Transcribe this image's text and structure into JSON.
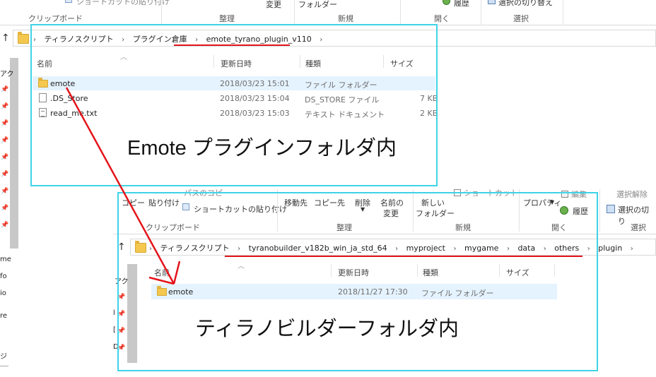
{
  "top_window": {
    "ribbon": {
      "shortcut_paste": "ショートカットの貼り付け",
      "clipboard": "クリップボード",
      "organize": "整理",
      "change": "変更",
      "folder": "フォルダー",
      "new": "新規",
      "open": "開く",
      "history": "履歴",
      "select_toggle": "選択の切り替え",
      "select": "選択"
    },
    "breadcrumb": [
      "ティラノスクリプト",
      "プラグイン倉庫",
      "emote_tyrano_plugin_v110"
    ],
    "columns": [
      "名前",
      "更新日時",
      "種類",
      "サイズ"
    ],
    "rows": [
      {
        "name": "emote",
        "date": "2018/03/23 15:01",
        "type": "ファイル フォルダー",
        "size": "",
        "icon": "folder-icon"
      },
      {
        "name": ".DS_Store",
        "date": "2018/03/23 15:04",
        "type": "DS_STORE ファイル",
        "size": "7 KB",
        "icon": "file-icon"
      },
      {
        "name": "read_me.txt",
        "date": "2018/03/23 15:03",
        "type": "テキスト ドキュメント",
        "size": "2 KB",
        "icon": "text-file-icon"
      }
    ],
    "sidebar_fragments": [
      "アク",
      "me",
      "fo",
      "io",
      "re",
      "ジ"
    ]
  },
  "bottom_window": {
    "ribbon": {
      "copy": "コピー",
      "paste": "貼り付け",
      "paste_path": "パスのコピー",
      "shortcut_paste": "ショートカットの貼り付け",
      "move_to": "移動先",
      "copy_to": "コピー先",
      "delete": "削除",
      "rename_1": "名前の",
      "rename_2": "変更",
      "new_1": "新しい",
      "new_2": "フォルダー",
      "shortcut": "ショートカット",
      "properties": "プロパティ",
      "edit": "編集",
      "history": "履歴",
      "select_all_clear": "選択解除",
      "select_toggle": "選択の切り",
      "clipboard": "クリップボード",
      "organize": "整理",
      "new": "新規",
      "open": "開く",
      "select": "選択"
    },
    "breadcrumb": [
      "ティラノスクリプト",
      "tyranobuilder_v182b_win_ja_std_64",
      "myproject",
      "mygame",
      "data",
      "others",
      "plugin"
    ],
    "columns": [
      "名前",
      "更新日時",
      "種類",
      "サイズ"
    ],
    "rows": [
      {
        "name": "emote",
        "date": "2018/11/27 17:30",
        "type": "ファイル フォルダー",
        "icon": "folder-icon"
      }
    ],
    "sidebar_fragments": [
      "アク",
      "l",
      "[",
      "D",
      "〉"
    ]
  },
  "annotations": {
    "top_label": "Emote プラグインフォルダ内",
    "bottom_label": "ティラノビルダーフォルダ内"
  },
  "colors": {
    "frame": "#3fd3e6",
    "arrow": "#e4141b",
    "selection": "#e5f3ff"
  }
}
